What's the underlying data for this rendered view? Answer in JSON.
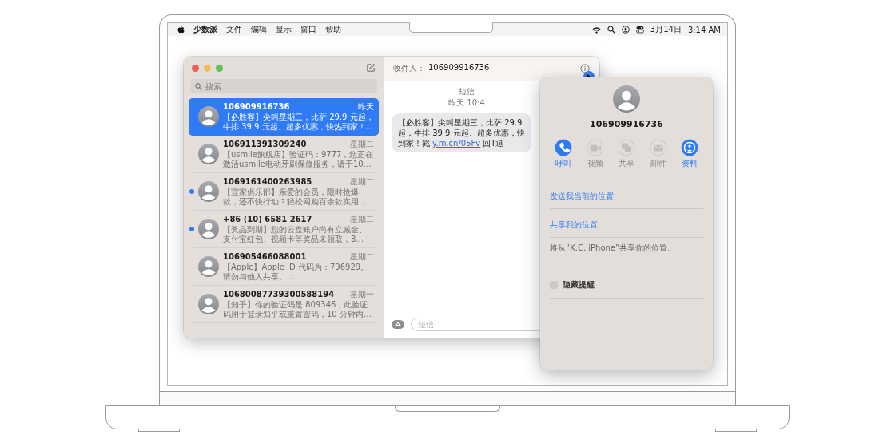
{
  "menubar": {
    "app": "少数派",
    "menus": [
      "文件",
      "编辑",
      "显示",
      "窗口",
      "帮助"
    ],
    "date": "3月14日",
    "time": "3:14 AM"
  },
  "sidebar": {
    "search": {
      "placeholder": "搜索"
    },
    "conversations": [
      {
        "name": "106909916736",
        "time": "昨天",
        "preview": "【必胜客】尖叫星期三，比萨 29.9 元起，牛排 39.9 元起。超多优惠，快热到家！…",
        "selected": true,
        "unread": false
      },
      {
        "name": "106911391309240",
        "time": "星期二",
        "preview": "【usmile旗舰店】验证码：9777，您正在激活usmile电动牙刷保修服务，请于10…",
        "selected": false,
        "unread": false
      },
      {
        "name": "1069161400263985",
        "time": "星期二",
        "preview": "【宜家俱乐部】亲爱的会员，限时抢爆款，还不快行动？轻松网购百余款实用…",
        "selected": false,
        "unread": true
      },
      {
        "name": "+86 (10) 6581 2617",
        "time": "星期二",
        "preview": "【奖品到期】您的云盘账户尚有立减金、支付宝红包、视频卡等奖品未领取，3…",
        "selected": false,
        "unread": true
      },
      {
        "name": "106905466088001",
        "time": "星期二",
        "preview": "【Apple】Apple ID 代码为：796929。请勿与他人共享。…",
        "selected": false,
        "unread": false
      },
      {
        "name": "10680087739300588194",
        "time": "星期一",
        "preview": "【知乎】你的验证码是 809346，此验证码用于登录知乎或重置密码，10 分钟内…",
        "selected": false,
        "unread": false
      }
    ]
  },
  "chat": {
    "recipient_label": "收件人：",
    "recipient": "106909916736",
    "service": "短信",
    "timestamp": "昨天 10:4",
    "message": {
      "lines": [
        {
          "text": "【必胜客】尖叫星期三，比萨 29.9"
        },
        {
          "text": "起，牛排 39.9 元起。超多优惠，快"
        },
        {
          "text": "到家！戳",
          "link": "y.m.cn/05Fv",
          "after": "回T退"
        }
      ]
    },
    "compose": {
      "placeholder": "短信"
    }
  },
  "popover": {
    "name": "106909916736",
    "actions": [
      {
        "kind": "phone",
        "label": "呼叫",
        "enabled": true
      },
      {
        "kind": "video",
        "label": "视频",
        "enabled": false
      },
      {
        "kind": "share",
        "label": "共享",
        "enabled": false
      },
      {
        "kind": "mail",
        "label": "邮件",
        "enabled": false
      },
      {
        "kind": "info",
        "label": "资料",
        "enabled": true
      }
    ],
    "links": [
      "发送我当前的位置",
      "共享我的位置"
    ],
    "note": "将从“K.C. iPhone”共享你的位置。",
    "hide_alerts": {
      "label": "隐藏提醒",
      "checked": false
    }
  }
}
